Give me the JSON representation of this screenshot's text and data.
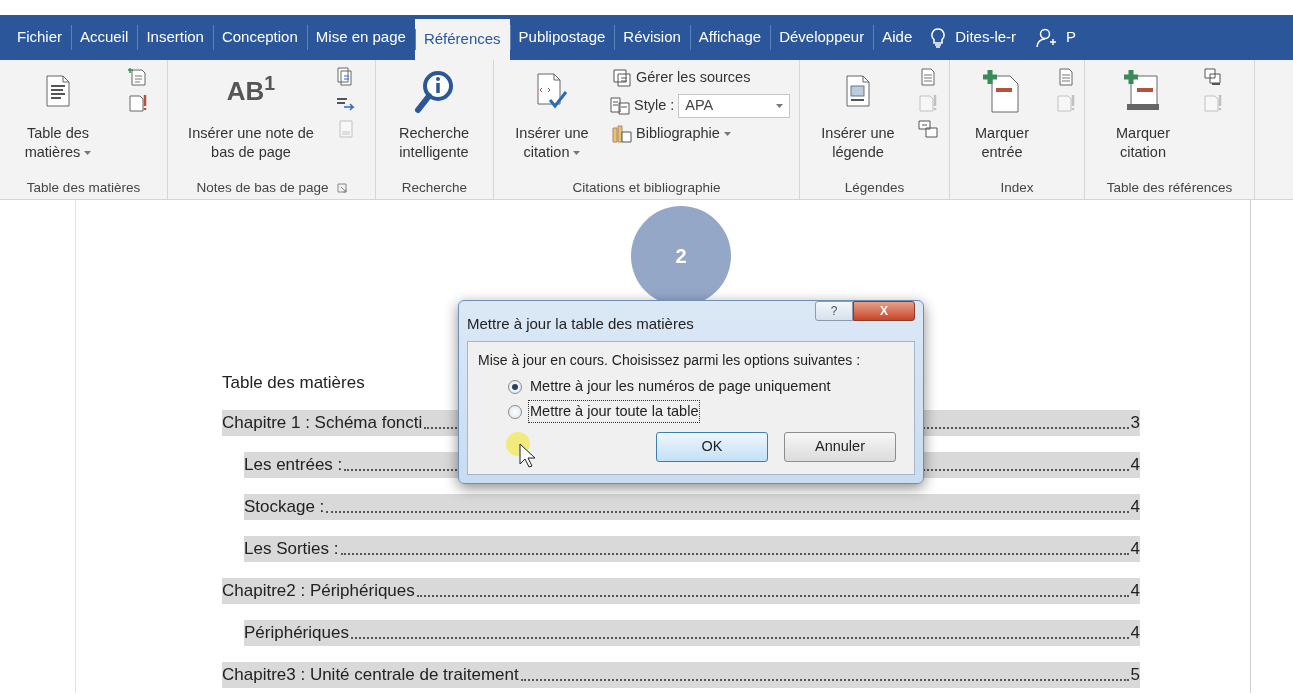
{
  "tabs": [
    {
      "label": "Fichier",
      "selected": false
    },
    {
      "label": "Accueil",
      "selected": false
    },
    {
      "label": "Insertion",
      "selected": false
    },
    {
      "label": "Conception",
      "selected": false
    },
    {
      "label": "Mise en page",
      "selected": false
    },
    {
      "label": "Références",
      "selected": true
    },
    {
      "label": "Publipostage",
      "selected": false
    },
    {
      "label": "Révision",
      "selected": false
    },
    {
      "label": "Affichage",
      "selected": false
    },
    {
      "label": "Développeur",
      "selected": false
    },
    {
      "label": "Aide",
      "selected": false
    }
  ],
  "tell_me": {
    "label": "Dites-le-r"
  },
  "share": {
    "label": "P"
  },
  "ribbon_groups": [
    {
      "label": "Table des matières",
      "launcher": false,
      "large": {
        "kind": "toc",
        "label": "Table des matières",
        "dropdown": true
      },
      "small": [
        {
          "kind": "add-text",
          "disabled": false
        },
        {
          "kind": "update",
          "disabled": false
        }
      ]
    },
    {
      "label": "Notes de bas de page",
      "launcher": true,
      "large": {
        "kind": "footnote",
        "icon_text": "AB$^{1}$",
        "label": "Insérer une note de bas de page",
        "dropdown": false
      },
      "small": [
        {
          "kind": "endnote",
          "disabled": false
        },
        {
          "kind": "next-note",
          "disabled": false
        },
        {
          "kind": "show-notes",
          "disabled": true
        }
      ]
    },
    {
      "label": "Recherche",
      "launcher": false,
      "large": {
        "kind": "search",
        "label": "Recherche intelligente",
        "dropdown": false
      }
    },
    {
      "label": "Citations et bibliographie",
      "launcher": false,
      "large": {
        "kind": "citation",
        "label": "Insérer une citation",
        "dropdown": true
      },
      "small": [
        {
          "kind": "sources",
          "label": "Gérer les sources",
          "disabled": false
        },
        {
          "kind": "style",
          "label": "Style :",
          "value": "APA",
          "disabled": false
        },
        {
          "kind": "bibliography",
          "label": "Bibliographie",
          "dropdown": true,
          "disabled": false
        }
      ]
    },
    {
      "label": "Légendes",
      "launcher": false,
      "large": {
        "kind": "caption",
        "label": "Insérer une légende",
        "dropdown": false
      },
      "small": [
        {
          "kind": "figure-table",
          "disabled": false
        },
        {
          "kind": "update",
          "disabled": true
        },
        {
          "kind": "cross-ref",
          "disabled": false
        }
      ]
    },
    {
      "label": "Index",
      "launcher": false,
      "large": {
        "kind": "mark-entry",
        "label": "Marquer entrée",
        "dropdown": false
      },
      "small": [
        {
          "kind": "index",
          "disabled": false
        },
        {
          "kind": "update",
          "disabled": true
        }
      ]
    },
    {
      "label": "Table des références",
      "launcher": false,
      "large": {
        "kind": "mark-citation",
        "label": "Marquer citation",
        "dropdown": false
      },
      "small": [
        {
          "kind": "authorities",
          "disabled": false
        },
        {
          "kind": "update",
          "disabled": true
        }
      ]
    }
  ],
  "step_badge": "2",
  "document": {
    "heading": "Table des matières",
    "toc": [
      {
        "title": "Chapitre 1 : Schéma foncti",
        "page": "3",
        "children": [
          {
            "title": "Les entrées :",
            "page": "4"
          },
          {
            "title": "Stockage :",
            "page": "4"
          },
          {
            "title": "Les Sorties :",
            "page": "4"
          }
        ]
      },
      {
        "title": "Chapitre2 : Périphériques",
        "page": "4",
        "children": [
          {
            "title": "Périphériques",
            "page": "4"
          }
        ]
      },
      {
        "title": "Chapitre3 : Unité centrale de traitement",
        "page": "5"
      }
    ]
  },
  "dialog": {
    "title": "Mettre à jour la table des matières",
    "help": "?",
    "close": "X",
    "message": "Mise à jour en cours. Choisissez parmi les options suivantes :",
    "options": [
      {
        "label": "Mettre à jour les numéros de page uniquement",
        "selected": true,
        "focused": false
      },
      {
        "label": "Mettre à jour toute la table",
        "selected": false,
        "focused": true
      }
    ],
    "buttons": [
      {
        "label": "OK",
        "default": true
      },
      {
        "label": "Annuler",
        "default": false
      }
    ]
  }
}
